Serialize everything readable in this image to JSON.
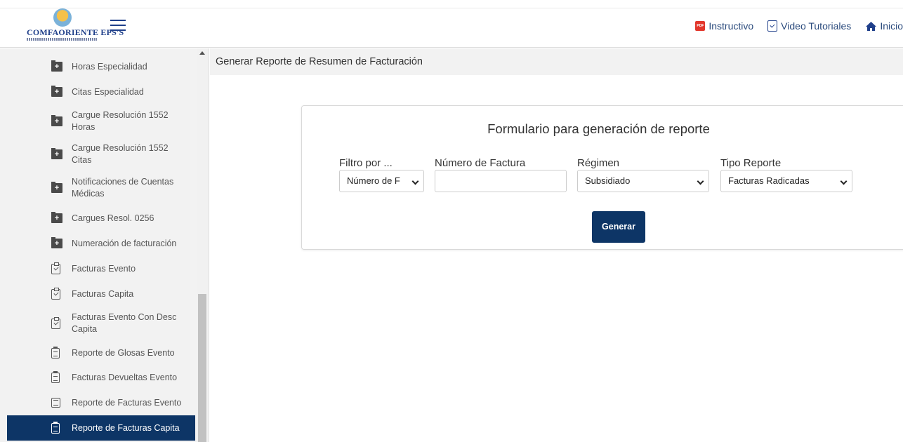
{
  "header": {
    "logo_text": "COMFAORIENTE EPS'S",
    "links": [
      {
        "label": "Instructivo",
        "icon": "pdf-icon"
      },
      {
        "label": "Video Tutoriales",
        "icon": "clipboard-check-icon"
      },
      {
        "label": "Inicio",
        "icon": "home-icon"
      }
    ],
    "pdf_badge": "PDF"
  },
  "sidebar": {
    "items": [
      {
        "label": "Horas Especialidad",
        "icon": "folder-plus-icon"
      },
      {
        "label": "Citas Especialidad",
        "icon": "folder-plus-icon"
      },
      {
        "label": "Cargue Resolución 1552 Horas",
        "icon": "folder-plus-icon"
      },
      {
        "label": "Cargue Resolución 1552 Citas",
        "icon": "folder-plus-icon"
      },
      {
        "label": "Notificaciones de Cuentas Médicas",
        "icon": "folder-plus-icon"
      },
      {
        "label": "Cargues Resol. 0256",
        "icon": "folder-plus-icon"
      },
      {
        "label": "Numeración de facturación",
        "icon": "folder-plus-icon"
      },
      {
        "label": "Facturas Evento",
        "icon": "clipboard-check-icon"
      },
      {
        "label": "Facturas Capita",
        "icon": "clipboard-check-icon"
      },
      {
        "label": "Facturas Evento Con Desc Capita",
        "icon": "clipboard-check-icon"
      },
      {
        "label": "Reporte de Glosas Evento",
        "icon": "report-icon"
      },
      {
        "label": "Facturas Devueltas Evento",
        "icon": "report-icon"
      },
      {
        "label": "Reporte de Facturas Evento",
        "icon": "list-icon"
      },
      {
        "label": "Reporte de Facturas Capita",
        "icon": "report-icon",
        "active": true
      }
    ]
  },
  "main": {
    "page_title": "Generar Reporte de Resumen de Facturación",
    "form": {
      "title": "Formulario para generación de reporte",
      "filtro_label": "Filtro por ...",
      "filtro_value": "Número de F",
      "numero_label": "Número de Factura",
      "numero_value": "",
      "regimen_label": "Régimen",
      "regimen_value": "Subsidiado",
      "tipo_label": "Tipo Reporte",
      "tipo_value": "Facturas Radicadas",
      "submit_label": "Generar"
    }
  },
  "colors": {
    "primary": "#0d3566",
    "sidebar_bg": "#f2f2f2",
    "pdf_red": "#e2362b"
  }
}
